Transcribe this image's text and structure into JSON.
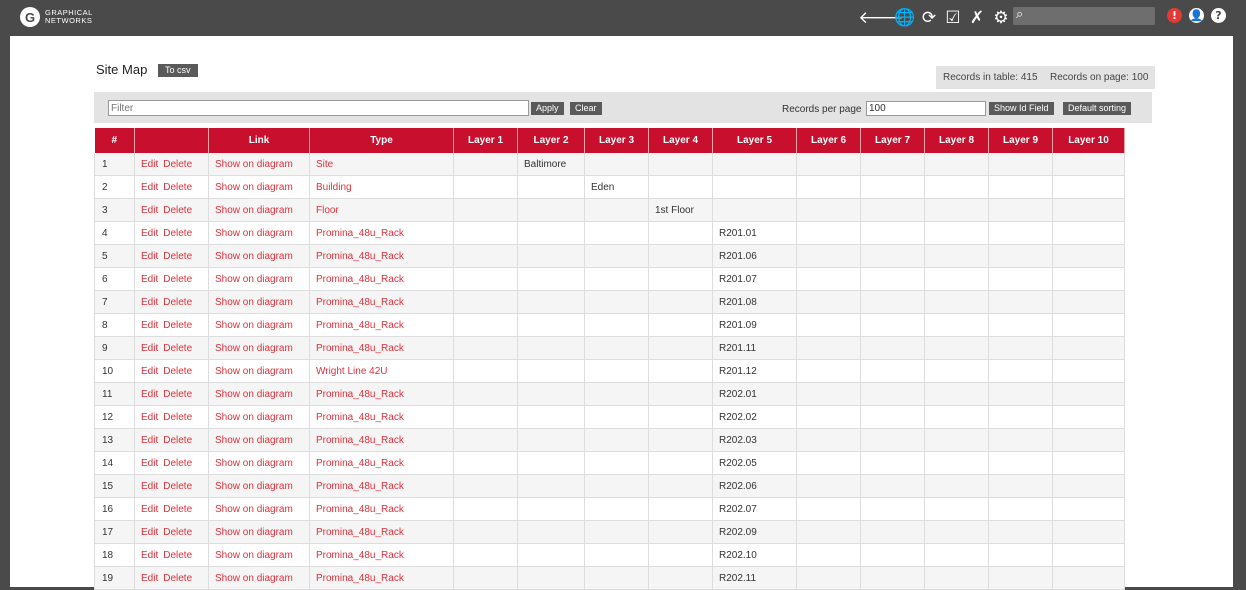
{
  "brand": {
    "line1": "GRAPHICAL",
    "line2": "NETWORKS",
    "mark": "G"
  },
  "toolbar": {
    "icons": [
      "back-arrow-icon",
      "globe-icon",
      "refresh-icon",
      "checklist-icon",
      "tools-icon",
      "settings-icon"
    ],
    "glyphs": [
      "🡐",
      "🌐",
      "⟳",
      "☑",
      "✗",
      "⚙"
    ],
    "search_value": "",
    "alert_glyph": "!",
    "user_glyph": "👤",
    "help_glyph": "?"
  },
  "page": {
    "title": "Site Map",
    "csv_button": "To csv",
    "records_in_table": "Records in table: 415",
    "records_on_page": "Records on page: 100"
  },
  "filter": {
    "placeholder": "Filter",
    "value": "",
    "apply": "Apply",
    "clear": "Clear",
    "rpp_label": "Records per page",
    "rpp_value": "100",
    "show_id": "Show Id Field",
    "default_sorting": "Default sorting"
  },
  "table": {
    "columns": [
      "#",
      "",
      "Link",
      "Type",
      "Layer 1",
      "Layer 2",
      "Layer 3",
      "Layer 4",
      "Layer 5",
      "Layer 6",
      "Layer 7",
      "Layer 8",
      "Layer 9",
      "Layer 10"
    ],
    "edit_label": "Edit",
    "delete_label": "Delete",
    "link_label": "Show on diagram",
    "rows": [
      {
        "n": "1",
        "type": "Site",
        "layers": [
          "",
          "Baltimore",
          "",
          "",
          "",
          "",
          "",
          "",
          "",
          ""
        ]
      },
      {
        "n": "2",
        "type": "Building",
        "layers": [
          "",
          "",
          "Eden",
          "",
          "",
          "",
          "",
          "",
          "",
          ""
        ]
      },
      {
        "n": "3",
        "type": "Floor",
        "layers": [
          "",
          "",
          "",
          "1st Floor",
          "",
          "",
          "",
          "",
          "",
          ""
        ]
      },
      {
        "n": "4",
        "type": "Promina_48u_Rack",
        "layers": [
          "",
          "",
          "",
          "",
          "R201.01",
          "",
          "",
          "",
          "",
          ""
        ]
      },
      {
        "n": "5",
        "type": "Promina_48u_Rack",
        "layers": [
          "",
          "",
          "",
          "",
          "R201.06",
          "",
          "",
          "",
          "",
          ""
        ]
      },
      {
        "n": "6",
        "type": "Promina_48u_Rack",
        "layers": [
          "",
          "",
          "",
          "",
          "R201.07",
          "",
          "",
          "",
          "",
          ""
        ]
      },
      {
        "n": "7",
        "type": "Promina_48u_Rack",
        "layers": [
          "",
          "",
          "",
          "",
          "R201.08",
          "",
          "",
          "",
          "",
          ""
        ]
      },
      {
        "n": "8",
        "type": "Promina_48u_Rack",
        "layers": [
          "",
          "",
          "",
          "",
          "R201.09",
          "",
          "",
          "",
          "",
          ""
        ]
      },
      {
        "n": "9",
        "type": "Promina_48u_Rack",
        "layers": [
          "",
          "",
          "",
          "",
          "R201.11",
          "",
          "",
          "",
          "",
          ""
        ]
      },
      {
        "n": "10",
        "type": "Wright Line 42U",
        "layers": [
          "",
          "",
          "",
          "",
          "R201.12",
          "",
          "",
          "",
          "",
          ""
        ]
      },
      {
        "n": "11",
        "type": "Promina_48u_Rack",
        "layers": [
          "",
          "",
          "",
          "",
          "R202.01",
          "",
          "",
          "",
          "",
          ""
        ]
      },
      {
        "n": "12",
        "type": "Promina_48u_Rack",
        "layers": [
          "",
          "",
          "",
          "",
          "R202.02",
          "",
          "",
          "",
          "",
          ""
        ]
      },
      {
        "n": "13",
        "type": "Promina_48u_Rack",
        "layers": [
          "",
          "",
          "",
          "",
          "R202.03",
          "",
          "",
          "",
          "",
          ""
        ]
      },
      {
        "n": "14",
        "type": "Promina_48u_Rack",
        "layers": [
          "",
          "",
          "",
          "",
          "R202.05",
          "",
          "",
          "",
          "",
          ""
        ]
      },
      {
        "n": "15",
        "type": "Promina_48u_Rack",
        "layers": [
          "",
          "",
          "",
          "",
          "R202.06",
          "",
          "",
          "",
          "",
          ""
        ]
      },
      {
        "n": "16",
        "type": "Promina_48u_Rack",
        "layers": [
          "",
          "",
          "",
          "",
          "R202.07",
          "",
          "",
          "",
          "",
          ""
        ]
      },
      {
        "n": "17",
        "type": "Promina_48u_Rack",
        "layers": [
          "",
          "",
          "",
          "",
          "R202.09",
          "",
          "",
          "",
          "",
          ""
        ]
      },
      {
        "n": "18",
        "type": "Promina_48u_Rack",
        "layers": [
          "",
          "",
          "",
          "",
          "R202.10",
          "",
          "",
          "",
          "",
          ""
        ]
      },
      {
        "n": "19",
        "type": "Promina_48u_Rack",
        "layers": [
          "",
          "",
          "",
          "",
          "R202.11",
          "",
          "",
          "",
          "",
          ""
        ]
      }
    ]
  },
  "colors": {
    "header_bar": "#4a4a4a",
    "table_header": "#c8102e",
    "link": "#e0303a",
    "alert": "#e53935"
  }
}
